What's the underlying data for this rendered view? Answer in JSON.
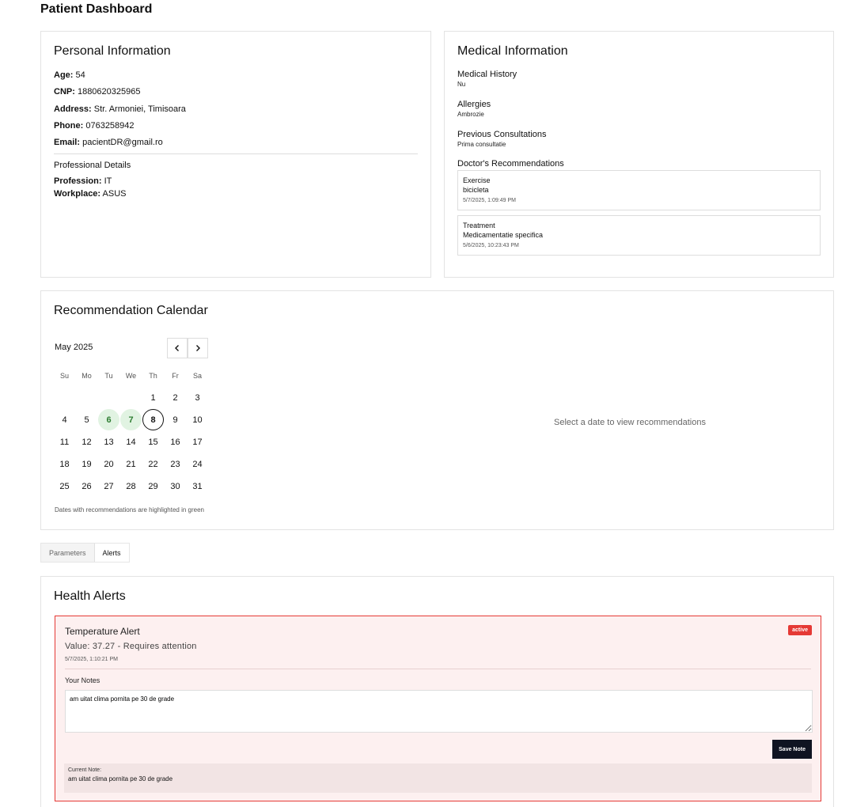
{
  "page": {
    "title": "Patient Dashboard"
  },
  "personal": {
    "title": "Personal Information",
    "rows": [
      {
        "label": "Age:",
        "value": "54"
      },
      {
        "label": "CNP:",
        "value": "1880620325965"
      },
      {
        "label": "Address:",
        "value": "Str. Armoniei, Timisoara"
      },
      {
        "label": "Phone:",
        "value": "0763258942"
      },
      {
        "label": "Email:",
        "value": "pacientDR@gmail.ro"
      }
    ],
    "professional_title": "Professional Details",
    "professional": [
      {
        "label": "Profession:",
        "value": "IT"
      },
      {
        "label": "Workplace:",
        "value": "ASUS"
      }
    ]
  },
  "medical": {
    "title": "Medical Information",
    "history_label": "Medical History",
    "history_value": "Nu",
    "allergies_label": "Allergies",
    "allergies_value": "Ambrozie",
    "consult_label": "Previous Consultations",
    "consult_value": "Prima consultatie",
    "recs_label": "Doctor's Recommendations",
    "recommendations": [
      {
        "type": "Exercise",
        "text": "bicicleta",
        "date": "5/7/2025, 1:09:49 PM"
      },
      {
        "type": "Treatment",
        "text": "Medicamentatie specifica",
        "date": "5/6/2025, 10:23:43 PM"
      }
    ]
  },
  "calendar": {
    "title": "Recommendation Calendar",
    "month": "May 2025",
    "weekdays": [
      "Su",
      "Mo",
      "Tu",
      "We",
      "Th",
      "Fr",
      "Sa"
    ],
    "first_weekday_index": 4,
    "days_in_month": 31,
    "highlighted_days": [
      6,
      7
    ],
    "today": 8,
    "note": "Dates with recommendations are highlighted in green",
    "empty_text": "Select a date to view recommendations"
  },
  "tabs": [
    {
      "label": "Parameters",
      "active": false
    },
    {
      "label": "Alerts",
      "active": true
    }
  ],
  "alerts": {
    "title": "Health Alerts",
    "items": [
      {
        "title": "Temperature Alert",
        "value_text": "Value: 37.27 - Requires attention",
        "date": "5/7/2025, 1:10:21 PM",
        "status": "active",
        "notes_label": "Your Notes",
        "notes_value": "am uitat clima pornita pe 30 de grade",
        "save_label": "Save Note",
        "current_label": "Current Note:",
        "current_text": "am uitat clima pornita pe 30 de grade"
      }
    ]
  },
  "colors": {
    "highlight": "#e1f3e2",
    "alert_border": "#e53935",
    "alert_bg": "#fdf0f0",
    "button_dark": "#0f1422"
  }
}
